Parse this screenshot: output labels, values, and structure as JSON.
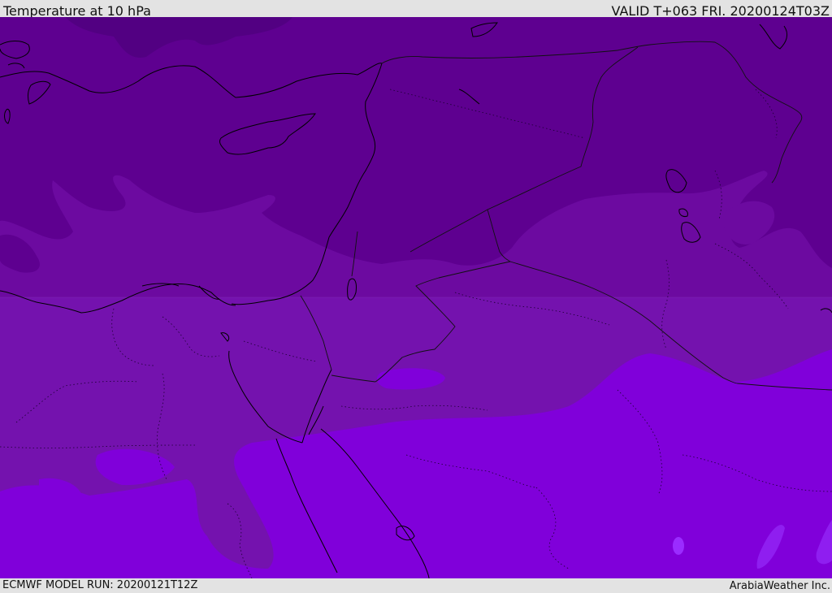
{
  "header": {
    "title": "Temperature at 10 hPa",
    "valid": "VALID T+063 FRI. 20200124T03Z"
  },
  "footer": {
    "model_run": "ECMWF MODEL RUN: 20200121T12Z",
    "credit": "ArabiaWeather Inc."
  },
  "palette": {
    "band_coldest": "#5e0090",
    "band_cold": "#6c0aa0",
    "band_mid": "#7412ae",
    "band_warm": "#8000da",
    "band_warmest": "#8f1ef0",
    "coastline": "#000000",
    "border": "#111111"
  }
}
